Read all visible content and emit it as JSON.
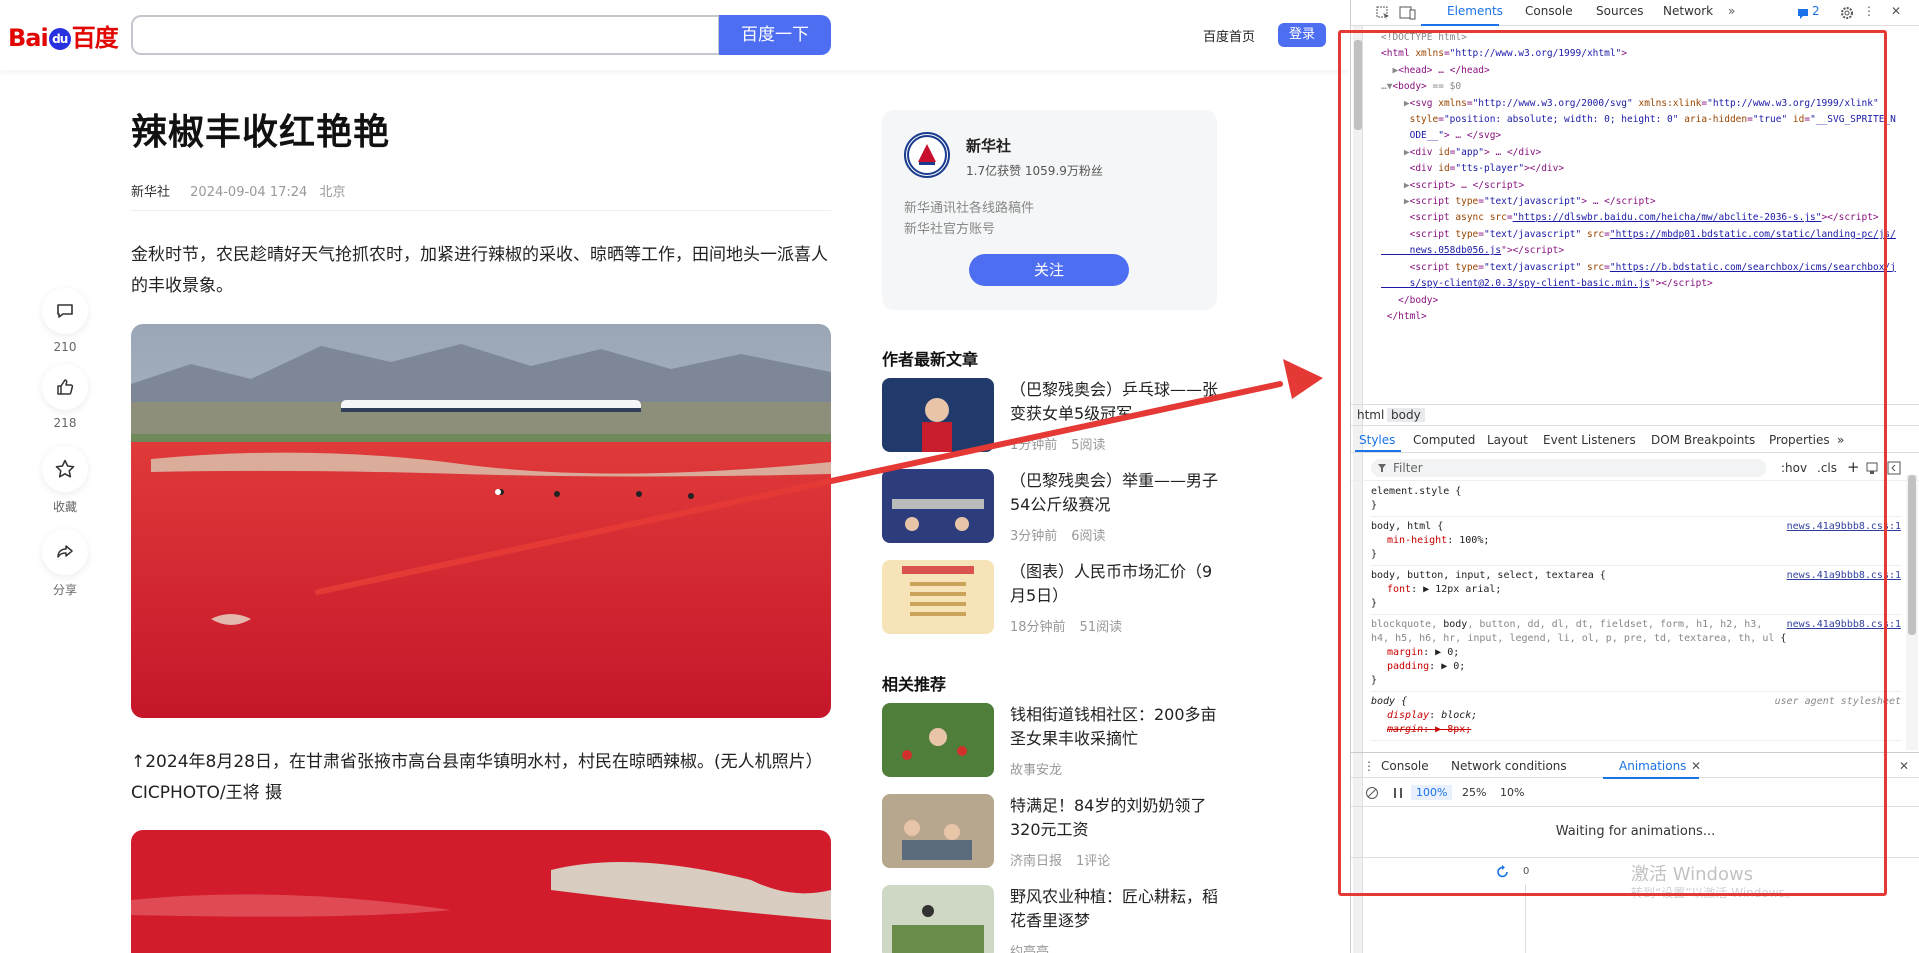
{
  "header": {
    "logo_text_left": "Bai",
    "logo_paw_text": "du",
    "logo_text_right": "百度",
    "search_placeholder": "",
    "search_button": "百度一下",
    "home_link": "百度首页",
    "login_button": "登录"
  },
  "article": {
    "title": "辣椒丰收红艳艳",
    "source": "新华社",
    "time": "2024-09-04 17:24",
    "location": "北京",
    "paragraph": "金秋时节，农民趁晴好天气抢抓农时，加紧进行辣椒的采收、晾晒等工作，田间地头一派喜人的丰收景象。",
    "caption": "↑2024年8月28日，在甘肃省张掖市高台县南华镇明水村，村民在晾晒辣椒。(无人机照片）CICPHOTO/王将 摄"
  },
  "actions": {
    "comment_count": "210",
    "like_count": "218",
    "favorite_label": "收藏",
    "share_label": "分享"
  },
  "author": {
    "name": "新华社",
    "stats": "1.7亿获赞 1059.9万粉丝",
    "desc_line1": "新华通讯社各线路稿件",
    "desc_line2": "新华社官方账号",
    "follow_button": "关注"
  },
  "latest": {
    "title": "作者最新文章",
    "items": [
      {
        "title": "（巴黎残奥会）乒乓球——张变获女单5级冠军",
        "time": "1分钟前",
        "reads": "5阅读"
      },
      {
        "title": "（巴黎残奥会）举重——男子54公斤级赛况",
        "time": "3分钟前",
        "reads": "6阅读"
      },
      {
        "title": "（图表）人民币市场汇价（9月5日）",
        "time": "18分钟前",
        "reads": "51阅读"
      }
    ]
  },
  "related": {
    "title": "相关推荐",
    "items": [
      {
        "title": "钱相街道钱相社区：200多亩圣女果丰收采摘忙",
        "source": "故事安龙",
        "extra": ""
      },
      {
        "title": "特满足！84岁的刘奶奶领了320元工资",
        "source": "济南日报",
        "extra": "1评论"
      },
      {
        "title": "野风农业种植：匠心耕耘，稻花香里逐梦",
        "source": "约亭亭",
        "extra": ""
      }
    ]
  },
  "devtools": {
    "tabs": [
      "Elements",
      "Console",
      "Sources",
      "Network"
    ],
    "issues_count": "2",
    "breadcrumbs": [
      "html",
      "body"
    ],
    "subtabs": [
      "Styles",
      "Computed",
      "Layout",
      "Event Listeners",
      "DOM Breakpoints",
      "Properties"
    ],
    "filter_placeholder": "Filter",
    "hov": ":hov",
    "cls": ".cls",
    "drawer_tabs": [
      "Console",
      "Network conditions",
      "Animations"
    ],
    "speeds": [
      "100%",
      "25%",
      "10%"
    ],
    "waiting": "Waiting for animations...",
    "timeline_zero": "0",
    "watermark1": "激活 Windows",
    "watermark2": "转到“设置”以激活 Windows。",
    "css_source": "news.41a9bbb8.css:1",
    "user_agent": "user agent stylesheet"
  },
  "colors": {
    "accent": "#4e6ef2",
    "annotation_red": "#e53935",
    "devtools_blue": "#1a73e8"
  }
}
